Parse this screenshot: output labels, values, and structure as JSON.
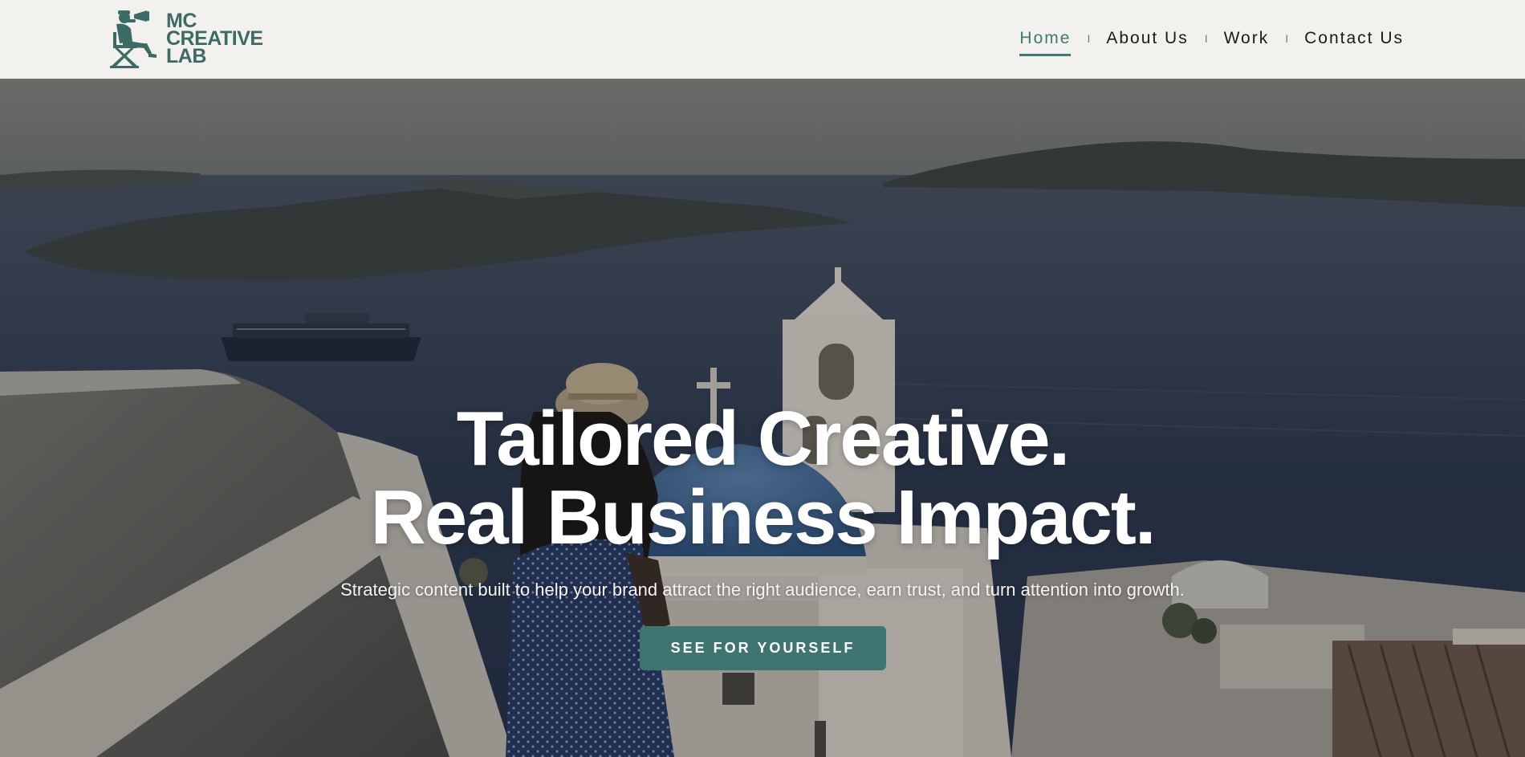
{
  "brand": {
    "logo_lines": [
      "MC",
      "CREATIVE",
      "LAB"
    ],
    "logo_icon": "director-with-megaphone-icon",
    "color": "#3c6b66"
  },
  "nav": {
    "items": [
      {
        "label": "Home",
        "active": true
      },
      {
        "label": "About Us",
        "active": false
      },
      {
        "label": "Work",
        "active": false
      },
      {
        "label": "Contact Us",
        "active": false
      }
    ],
    "separator": "I",
    "active_color": "#3c7a73"
  },
  "hero": {
    "headline_lines": [
      "Tailored Creative.",
      "Real Business Impact."
    ],
    "subheadline": "Strategic content built to help your brand attract the right audience, earn trust, and turn attention into growth.",
    "cta_label": "SEE FOR YOURSELF",
    "cta_color": "#3e7570",
    "background_image": "santorini-coastline-photo"
  }
}
